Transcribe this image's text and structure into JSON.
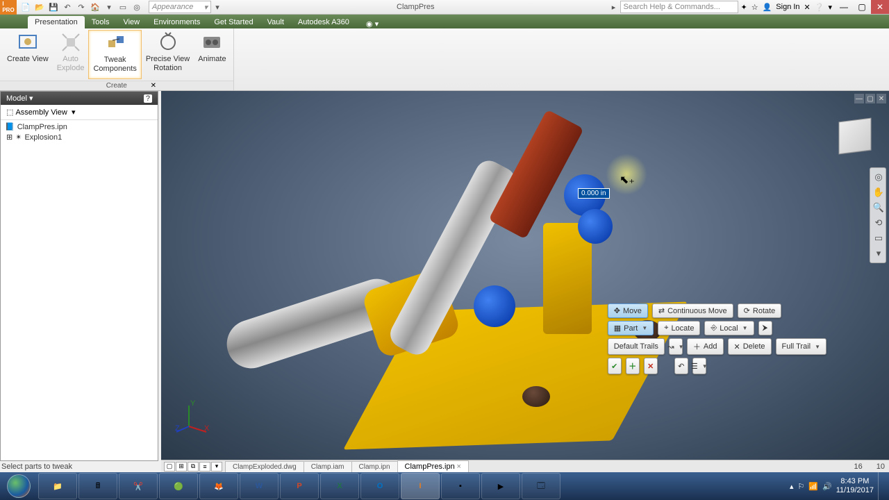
{
  "title": "ClampPres",
  "appearance_placeholder": "Appearance",
  "search_placeholder": "Search Help & Commands...",
  "signin": "Sign In",
  "ribbon_tabs": [
    "Presentation",
    "Tools",
    "View",
    "Environments",
    "Get Started",
    "Vault",
    "Autodesk A360"
  ],
  "ribbon_group_label": "Create",
  "ribbon_items": {
    "create_view": "Create View",
    "auto_explode": "Auto\nExplode",
    "tweak": "Tweak\nComponents",
    "precise": "Precise View\nRotation",
    "animate": "Animate"
  },
  "panel": {
    "title": "Model",
    "view": "Assembly View",
    "root": "ClampPres.ipn",
    "child": "Explosion1"
  },
  "dim_value": "0.000 in",
  "mini": {
    "move": "Move",
    "cont": "Continuous Move",
    "rotate": "Rotate",
    "part": "Part",
    "locate": "Locate",
    "local": "Local",
    "trails": "Default Trails",
    "add": "Add",
    "delete": "Delete",
    "full": "Full Trail"
  },
  "doc_tabs": [
    "ClampExploded.dwg",
    "Clamp.iam",
    "Clamp.ipn",
    "ClampPres.ipn"
  ],
  "status": "Select parts to tweak",
  "status_nums": {
    "a": "16",
    "b": "10"
  },
  "tray": {
    "time": "8:43 PM",
    "date": "11/19/2017"
  }
}
